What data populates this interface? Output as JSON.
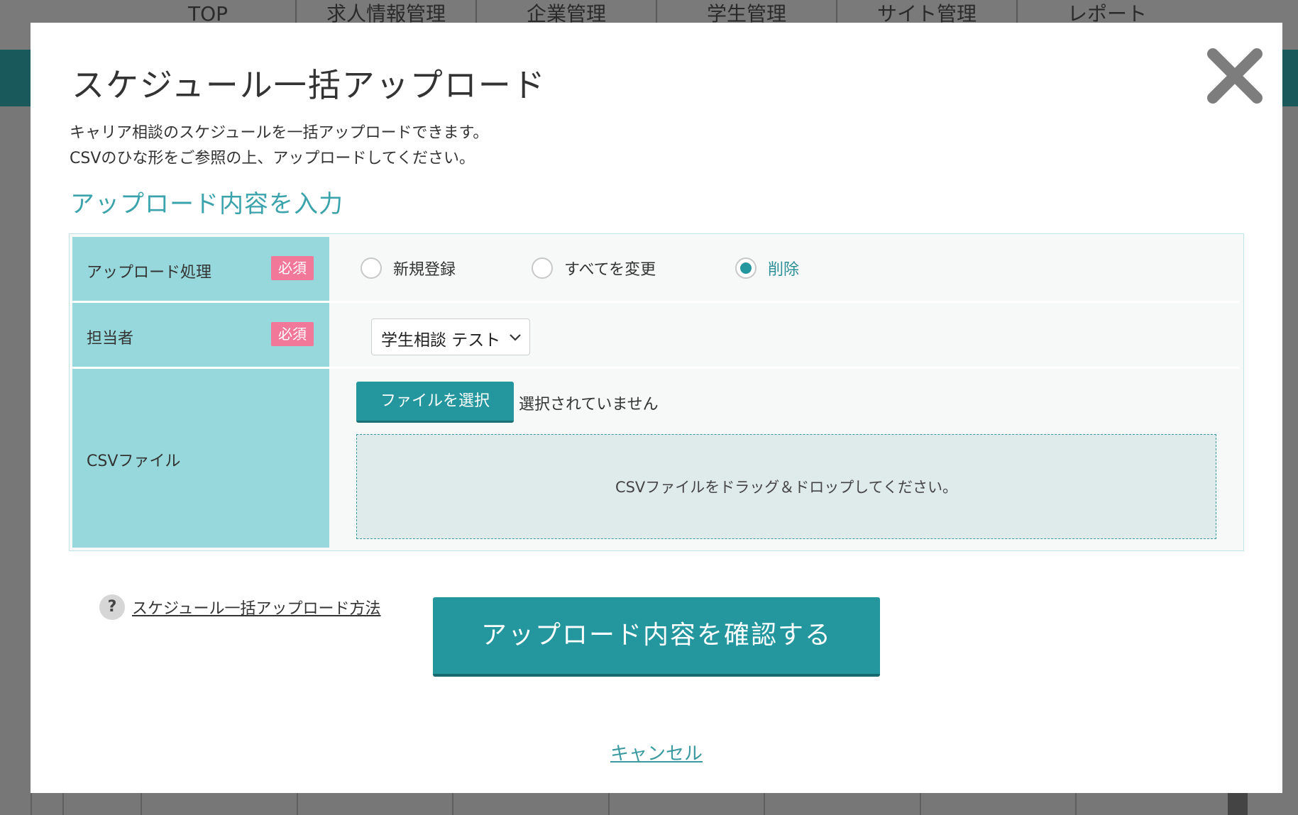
{
  "background_nav": {
    "items": [
      "TOP",
      "求人情報管理",
      "企業管理",
      "学生管理",
      "サイト管理",
      "レポート"
    ]
  },
  "modal": {
    "title": "スケジュール一括アップロード",
    "description_line1": "キャリア相談のスケジュールを一括アップロードできます。",
    "description_line2": "CSVのひな形をご参照の上、アップロードしてください。",
    "section_heading": "アップロード内容を入力",
    "close_icon": "close-icon",
    "form": {
      "upload_process": {
        "label": "アップロード処理",
        "required": "必須",
        "options": [
          {
            "label": "新規登録",
            "checked": false
          },
          {
            "label": "すべてを変更",
            "checked": false
          },
          {
            "label": "削除",
            "checked": true
          }
        ]
      },
      "person_in_charge": {
        "label": "担当者",
        "required": "必須",
        "selected": "学生相談 テスト"
      },
      "csv_file": {
        "label": "CSVファイル",
        "choose_button": "ファイルを選択",
        "status": "選択されていません",
        "dropzone_text": "CSVファイルをドラッグ＆ドロップしてください。"
      }
    },
    "help_link": "スケジュール一括アップロード方法",
    "help_icon": "question-icon",
    "confirm_button": "アップロード内容を確認する",
    "cancel_link": "キャンセル"
  },
  "colors": {
    "accent": "#24969e",
    "label_bg": "#97d8dc",
    "required_badge": "#f2789a",
    "heading": "#3ba3ab"
  }
}
